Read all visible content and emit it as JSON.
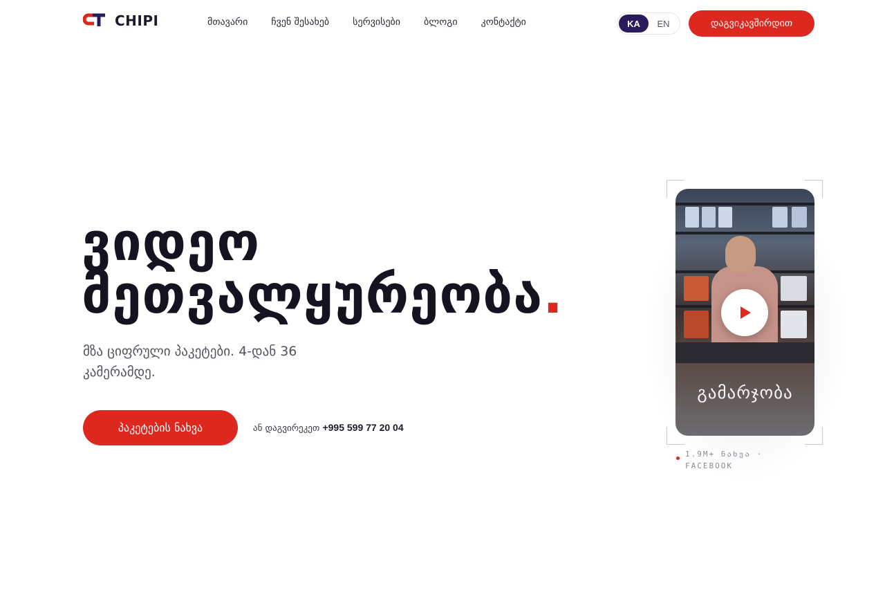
{
  "brand": {
    "name": "CHIPI",
    "red": "#dc281e",
    "navy": "#2a1b5c",
    "logo_mark": "CT"
  },
  "nav": {
    "items": [
      {
        "label": "მთავარი"
      },
      {
        "label": "ჩვენ შესახებ"
      },
      {
        "label": "სერვისები"
      },
      {
        "label": "ბლოგი"
      },
      {
        "label": "კონტაქტი"
      }
    ]
  },
  "lang": {
    "active": "KA",
    "inactive": "EN"
  },
  "header": {
    "contact_label": "დაგვიკავშირდით"
  },
  "hero": {
    "title_line1": "ვიდეო",
    "title_line2": "მეთვალყურეობა",
    "title_dot": ".",
    "subtitle": "მზა ციფრული პაკეტები. 4-დან 36 კამერამდე.",
    "cta_label": "პაკეტების ნახვა",
    "call_prefix": "ან დაგვირეკეთ",
    "phone": "+995 599 77 20 04"
  },
  "video": {
    "caption": "გამარჯობა",
    "play_icon": "play-icon",
    "views_text": "1.9M+ ნახვა · FACEBOOK"
  }
}
